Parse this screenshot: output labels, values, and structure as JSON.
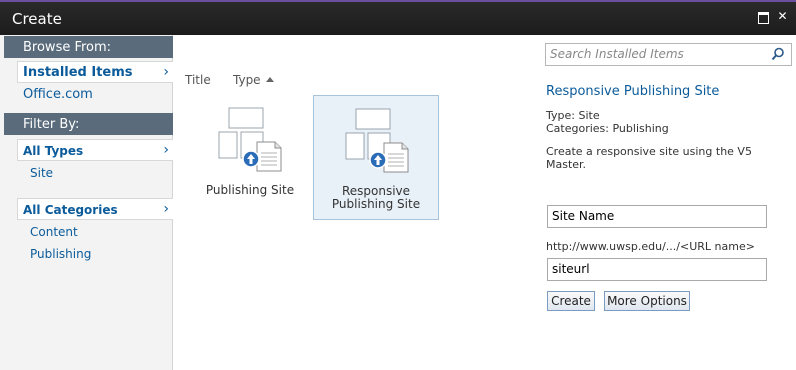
{
  "window": {
    "title": "Create"
  },
  "sidebar": {
    "browse_header": "Browse From:",
    "browse_items": [
      {
        "label": "Installed Items",
        "selected": true
      },
      {
        "label": "Office.com",
        "selected": false
      }
    ],
    "filter_header": "Filter By:",
    "type_filter": {
      "label": "All Types",
      "options": [
        "Site"
      ]
    },
    "category_filter": {
      "label": "All Categories",
      "options": [
        "Content",
        "Publishing"
      ]
    }
  },
  "list": {
    "columns": [
      "Title",
      "Type"
    ],
    "sort": "ascending",
    "tiles": [
      {
        "label": "Publishing Site",
        "selected": false
      },
      {
        "label": "Responsive Publishing Site",
        "selected": true
      }
    ]
  },
  "details": {
    "search_placeholder": "Search Installed Items",
    "title": "Responsive Publishing Site",
    "type_line": "Type: Site",
    "categories_line": "Categories: Publishing",
    "description": "Create a responsive site using the V5 Master.",
    "site_name_value": "Site Name",
    "url_hint": "http://www.uwsp.edu/.../<URL name>",
    "url_value": "siteurl",
    "create_label": "Create",
    "more_options_label": "More Options"
  },
  "colors": {
    "accent": "#0b5b9b",
    "header": "#5a6b7b",
    "titlebar": "#1c1c1c"
  }
}
